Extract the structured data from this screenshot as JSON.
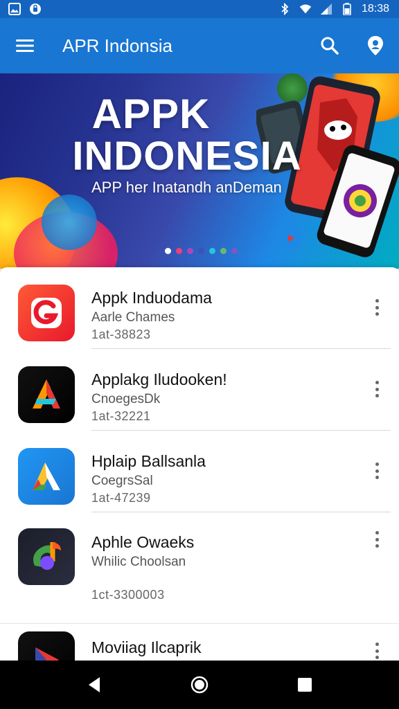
{
  "status_bar": {
    "time": "18:38",
    "left_icons": [
      "gallery-icon",
      "shield-icon"
    ],
    "right_icons": [
      "bluetooth-icon",
      "wifi-icon",
      "signal-icon",
      "battery-icon"
    ]
  },
  "app_bar": {
    "title": "APR Indonsia",
    "icons": [
      "menu-icon",
      "search-icon",
      "location-pin-icon"
    ]
  },
  "banner": {
    "title_line1": "APPK",
    "title_line2": "INDONESIA",
    "subtitle": "APP her Inatandh anDeman",
    "dots": {
      "count": 7,
      "active_index": 0,
      "colors": [
        "#ffffff",
        "#ec407a",
        "#ab47bc",
        "#3f51b5",
        "#26c6da",
        "#66bb6a",
        "#7e57c2"
      ]
    }
  },
  "apps": [
    {
      "name": "Appk Induodama",
      "subtitle": "Aarle Chames",
      "meta": "1at-38823",
      "icon": "g-logo-icon",
      "icon_colors": [
        "#ff5a36",
        "#e8192c"
      ]
    },
    {
      "name": "Applakg Iludooken!",
      "subtitle": "CnoegesDk",
      "meta": "1at-32221",
      "icon": "a-logo-icon",
      "icon_colors": [
        "#111111",
        "#000000"
      ]
    },
    {
      "name": "Hplaip Ballsanla",
      "subtitle": "CoegrsSal",
      "meta": "1at-47239",
      "icon": "a-triangle-icon",
      "icon_colors": [
        "#2196f3",
        "#1976d2"
      ]
    },
    {
      "name": "Aphle Owaeks",
      "subtitle": "Whilic Choolsan",
      "meta": "1ct-3300003",
      "icon": "music-note-icon",
      "icon_colors": [
        "#1c1e2b",
        "#2a2d3e"
      ]
    },
    {
      "name": "Moviiag Ilcaprik",
      "subtitle": "",
      "meta": "",
      "icon": "play-icon",
      "icon_colors": [
        "#111111",
        "#000000"
      ]
    }
  ],
  "nav_bar": {
    "buttons": [
      "back-icon",
      "home-icon",
      "recents-icon"
    ]
  },
  "colors": {
    "primary": "#1976d2",
    "status_bar": "#1565c0"
  }
}
